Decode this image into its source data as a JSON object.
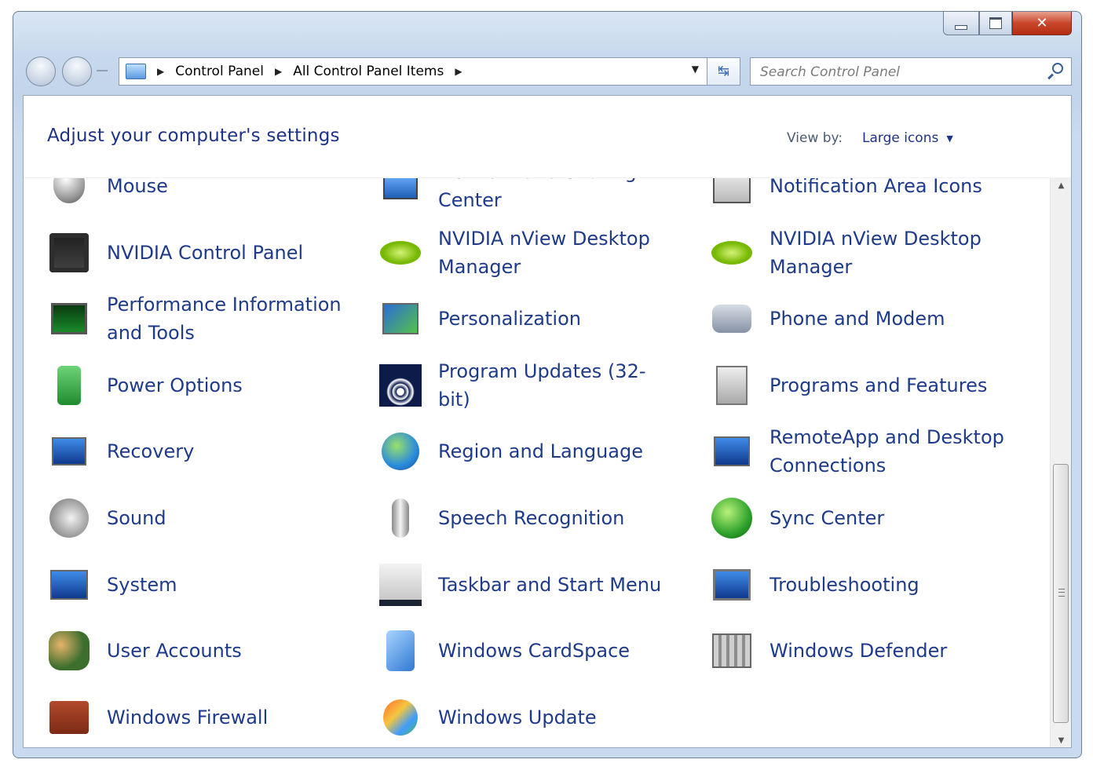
{
  "window": {
    "title_buttons": {
      "minimize": "minimize-icon",
      "maximize": "maximize-icon",
      "close": "close-icon"
    }
  },
  "nav": {
    "breadcrumb": [
      "Control Panel",
      "All Control Panel Items"
    ],
    "search_placeholder": "Search Control Panel"
  },
  "header": {
    "title": "Adjust your computer's settings",
    "view_by_label": "View by:",
    "view_by_value": "Large icons"
  },
  "items": [
    {
      "label": "Mouse",
      "icon": "mouse-icon"
    },
    {
      "label": "Network and Sharing Center",
      "icon": "network-icon"
    },
    {
      "label": "Notification Area Icons",
      "icon": "notification-icon"
    },
    {
      "label": "NVIDIA Control Panel",
      "icon": "nvidia-icon"
    },
    {
      "label": "NVIDIA nView Desktop Manager",
      "icon": "nvidia-eye-icon"
    },
    {
      "label": "NVIDIA nView Desktop Manager",
      "icon": "nvidia-eye-icon"
    },
    {
      "label": "Performance Information and Tools",
      "icon": "performance-icon"
    },
    {
      "label": "Personalization",
      "icon": "personalization-icon"
    },
    {
      "label": "Phone and Modem",
      "icon": "phone-icon"
    },
    {
      "label": "Power Options",
      "icon": "battery-icon"
    },
    {
      "label": "Program Updates (32-bit)",
      "icon": "program-updates-icon"
    },
    {
      "label": "Programs and Features",
      "icon": "programs-icon"
    },
    {
      "label": "Recovery",
      "icon": "recovery-icon"
    },
    {
      "label": "Region and Language",
      "icon": "globe-clock-icon"
    },
    {
      "label": "RemoteApp and Desktop Connections",
      "icon": "remoteapp-icon"
    },
    {
      "label": "Sound",
      "icon": "speaker-icon"
    },
    {
      "label": "Speech Recognition",
      "icon": "microphone-icon"
    },
    {
      "label": "Sync Center",
      "icon": "sync-icon"
    },
    {
      "label": "System",
      "icon": "system-icon"
    },
    {
      "label": "Taskbar and Start Menu",
      "icon": "taskbar-icon"
    },
    {
      "label": "Troubleshooting",
      "icon": "troubleshoot-icon"
    },
    {
      "label": "User Accounts",
      "icon": "users-icon"
    },
    {
      "label": "Windows CardSpace",
      "icon": "cardspace-icon"
    },
    {
      "label": "Windows Defender",
      "icon": "defender-icon"
    },
    {
      "label": "Windows Firewall",
      "icon": "firewall-icon"
    },
    {
      "label": "Windows Update",
      "icon": "windows-update-icon"
    }
  ]
}
